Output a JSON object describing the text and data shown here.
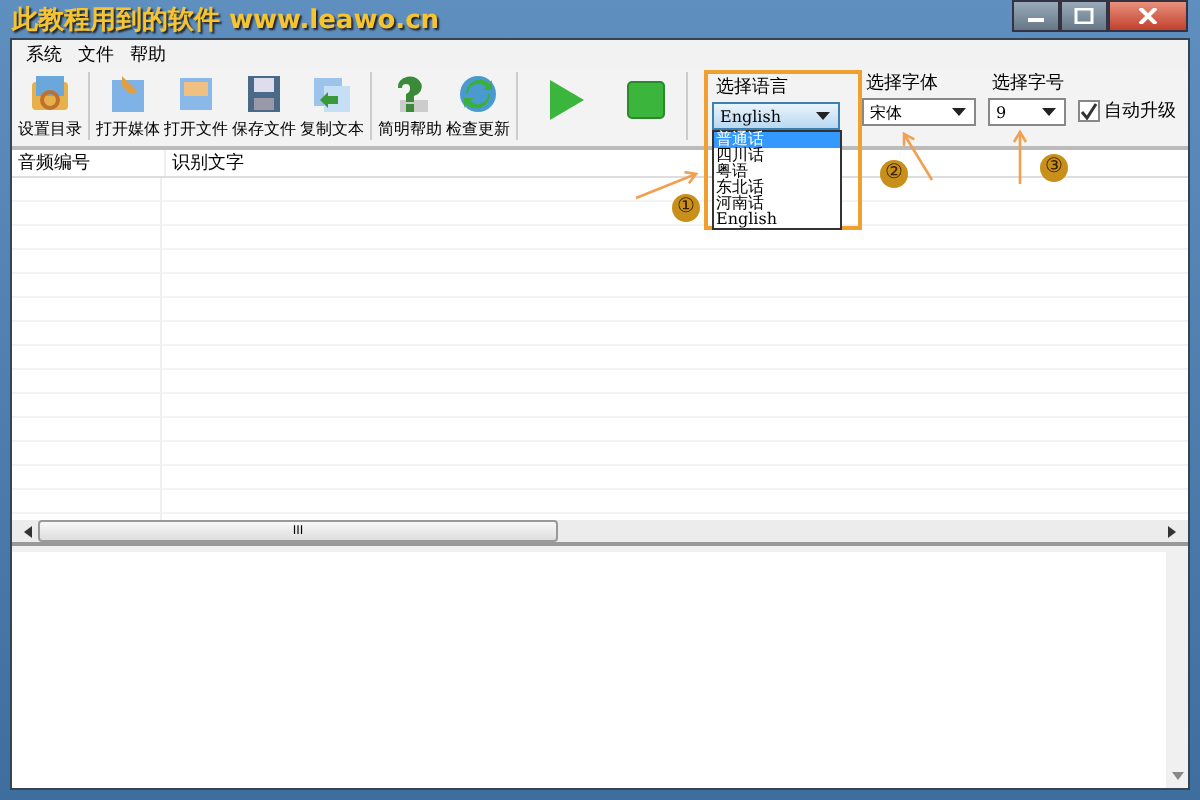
{
  "window": {
    "title": "此教程用到的软件 www.leawo.cn"
  },
  "menu": [
    "系统",
    "文件",
    "帮助"
  ],
  "toolbar": [
    {
      "label": "设置目录",
      "kind": "folder"
    },
    {
      "kind": "separator"
    },
    {
      "label": "打开媒体",
      "kind": "media"
    },
    {
      "label": "打开文件",
      "kind": "file"
    },
    {
      "label": "保存文件",
      "kind": "save"
    },
    {
      "label": "复制文本",
      "kind": "copy"
    },
    {
      "kind": "separator"
    },
    {
      "label": "简明帮助",
      "kind": "help"
    },
    {
      "label": "检查更新",
      "kind": "update"
    },
    {
      "kind": "separator"
    }
  ],
  "playback": [
    {
      "kind": "play"
    },
    {
      "kind": "stop"
    }
  ],
  "language": {
    "label": "选择语言",
    "value": "English",
    "options": [
      {
        "label": "普通话",
        "highlighted": true
      },
      {
        "label": "四川话",
        "highlighted": false
      },
      {
        "label": "粤语",
        "highlighted": false
      },
      {
        "label": "东北话",
        "highlighted": false
      },
      {
        "label": "河南话",
        "highlighted": false
      },
      {
        "label": "English",
        "highlighted": false
      }
    ]
  },
  "font": {
    "label": "选择字体",
    "value": "宋体"
  },
  "size": {
    "label": "选择字号",
    "value": "9"
  },
  "auto_upgrade": {
    "label": "自动升级",
    "checked": true
  },
  "table": {
    "columns": [
      "音频编号",
      "识别文字"
    ]
  },
  "scrollbar": {
    "grip": "III"
  },
  "annotations": [
    "①",
    "②",
    "③"
  ]
}
